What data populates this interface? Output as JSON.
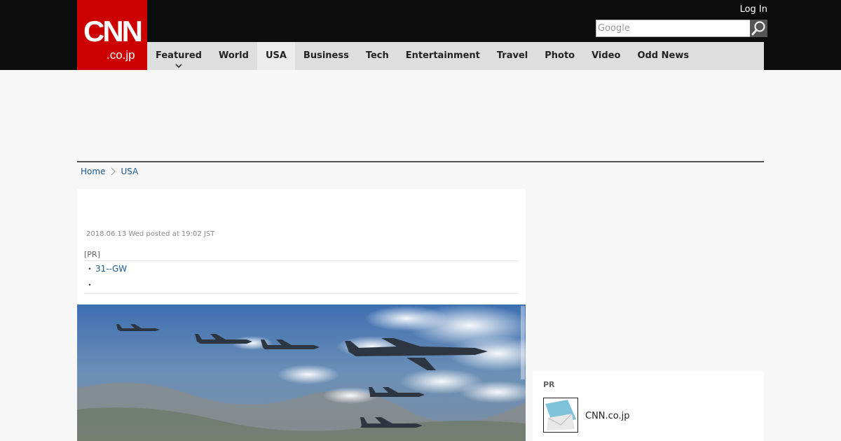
{
  "header": {
    "logo": {
      "main": "CNN",
      "sub": ".co.jp"
    },
    "login_label": "Log In",
    "search": {
      "placeholder": "Google",
      "button_icon": "search-icon"
    }
  },
  "nav": {
    "items": [
      {
        "label": "Featured",
        "has_dropdown": true
      },
      {
        "label": "World"
      },
      {
        "label": "USA",
        "active": true
      },
      {
        "label": "Business"
      },
      {
        "label": "Tech"
      },
      {
        "label": "Entertainment"
      },
      {
        "label": "Travel"
      },
      {
        "label": "Photo"
      },
      {
        "label": "Video"
      },
      {
        "label": "Odd News"
      }
    ]
  },
  "breadcrumb": {
    "home": "Home",
    "current": "USA"
  },
  "article": {
    "dateline": "2018.06.13 Wed posted at 19:02 JST",
    "pr_label": "[PR]",
    "pr_links": [
      "31--GW",
      ""
    ]
  },
  "sidebar": {
    "pr_label": "PR",
    "pr_item_text": "CNN.co.jp"
  },
  "colors": {
    "brand_red": "#cc0000",
    "topbar": "#0c0c0c",
    "nav_bg": "#dedede",
    "link": "#1a5a8e"
  }
}
